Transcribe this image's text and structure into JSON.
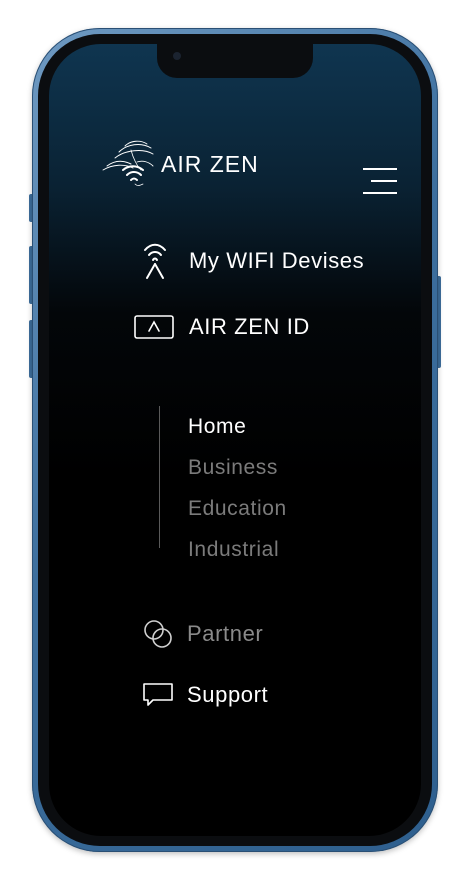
{
  "brand": {
    "name": "AIR ZEN",
    "logo_icon": "wifi-waves-logo-icon"
  },
  "header": {
    "menu_icon": "hamburger-menu-icon"
  },
  "menu": {
    "primary": [
      {
        "label": "My WIFI Devises",
        "icon": "wifi-antenna-icon"
      },
      {
        "label": "AIR ZEN ID",
        "icon": "id-card-icon"
      }
    ],
    "sub_items": [
      {
        "label": "Home",
        "active": true
      },
      {
        "label": "Business",
        "active": false
      },
      {
        "label": "Education",
        "active": false
      },
      {
        "label": "Industrial",
        "active": false
      }
    ],
    "secondary": [
      {
        "label": "Partner",
        "icon": "partner-circles-icon"
      },
      {
        "label": "Support",
        "icon": "chat-bubble-icon"
      }
    ]
  },
  "colors": {
    "text_active": "#ffffff",
    "text_inactive": "#7b7b7b",
    "frame_blue": "#3d6f9e",
    "screen_top": "#0f3550",
    "screen_bottom": "#000000"
  }
}
